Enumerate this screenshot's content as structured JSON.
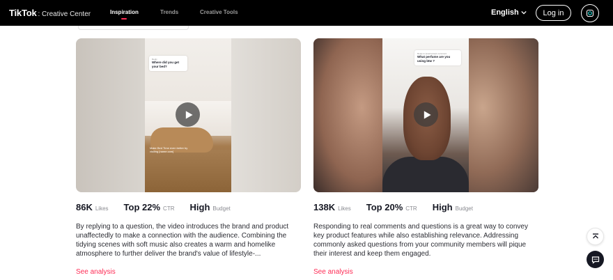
{
  "nav": {
    "logo_brand": "TikTok",
    "logo_sub": ": Creative Center",
    "links": [
      "Inspiration",
      "Trends",
      "Creative Tools"
    ],
    "active_link": "Inspiration",
    "language": "English",
    "login_label": "Log in",
    "icons": {
      "language": "chevron-down-icon",
      "profile": "camera-icon"
    }
  },
  "cards": [
    {
      "bubble_meta": "Reply",
      "bubble_text": "Where did you get your bed?",
      "caption": "Make Bed Time even better by visiting [name.com]",
      "likes": "86K",
      "likes_label": "Likes",
      "ctr": "Top 22%",
      "ctr_label": "CTR",
      "budget": "High",
      "budget_label": "Budget",
      "description": "By replying to a question, the video introduces the brand and product unaffectedly to make a connection with the audience. Combining the tidying scenes with soft music also creates a warm and homelike atmosphere to further deliver the brand's value of lifestyle-...",
      "see_analysis": "See analysis"
    },
    {
      "bubble_meta": "Reply to [username]'s comment",
      "bubble_text": "What perfume are you using btw ?",
      "likes": "138K",
      "likes_label": "Likes",
      "ctr": "Top 20%",
      "ctr_label": "CTR",
      "budget": "High",
      "budget_label": "Budget",
      "description": "Responding to real comments and questions is a great way to convey key product features while also establishing relevance. Addressing commonly asked questions from your community members will pique their interest and keep them engaged.",
      "see_analysis": "See analysis"
    }
  ],
  "floating": {
    "top_icon": "back-to-top-icon",
    "chat_icon": "chat-icon"
  },
  "colors": {
    "accent": "#fe2c55",
    "nav_bg": "#000000",
    "text": "#161823"
  }
}
